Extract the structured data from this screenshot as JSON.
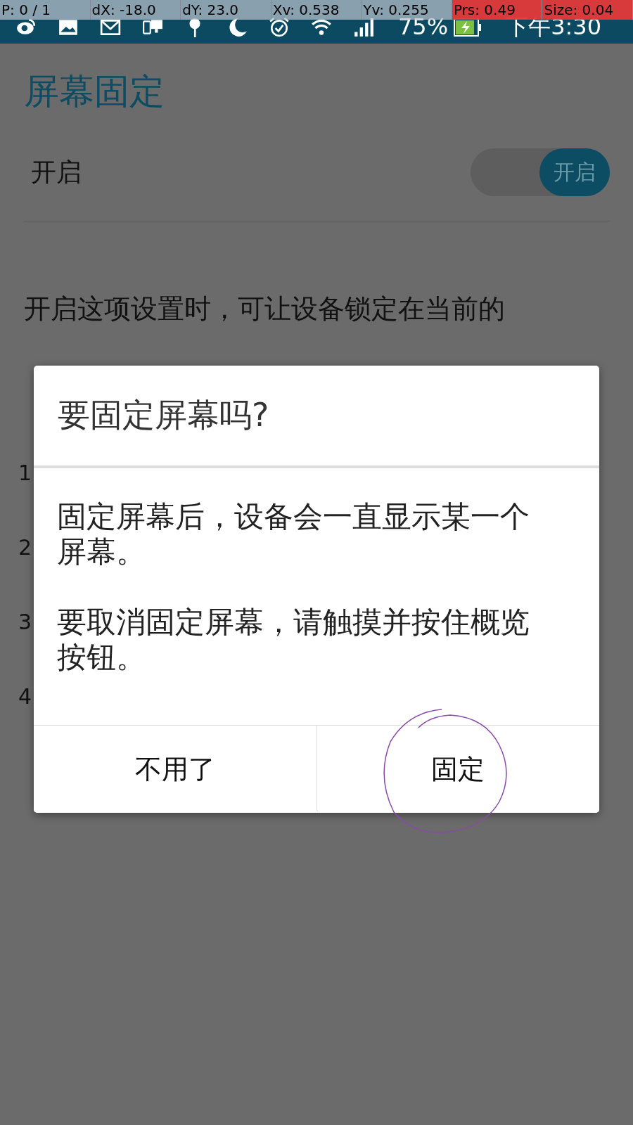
{
  "status_bar": {
    "debug_overlay": [
      {
        "text": "P: 0 / 1",
        "highlight": false
      },
      {
        "text": "dX: -18.0",
        "highlight": false
      },
      {
        "text": "dY: 23.0",
        "highlight": false
      },
      {
        "text": "Xv: 0.538",
        "highlight": false
      },
      {
        "text": "Yv: 0.255",
        "highlight": false
      },
      {
        "text": "Prs: 0.49",
        "highlight": true
      },
      {
        "text": "Size: 0.04",
        "highlight": true
      }
    ],
    "battery": "75%",
    "time": "下午3:30"
  },
  "page": {
    "title": "屏幕固定",
    "setting": {
      "label": "开启",
      "toggle": {
        "on": true,
        "label": "开启"
      }
    },
    "description": "开启这项设置时，可让设备锁定在当前的",
    "list_numbers": [
      "1",
      "2",
      "3",
      "4"
    ]
  },
  "dialog": {
    "title": "要固定屏幕吗?",
    "paragraphs": [
      "固定屏幕后，设备会一直显示某一个屏幕。",
      "要取消固定屏幕，请触摸并按住概览按钮。"
    ],
    "buttons": [
      {
        "label": "不用了"
      },
      {
        "label": "固定"
      }
    ]
  }
}
